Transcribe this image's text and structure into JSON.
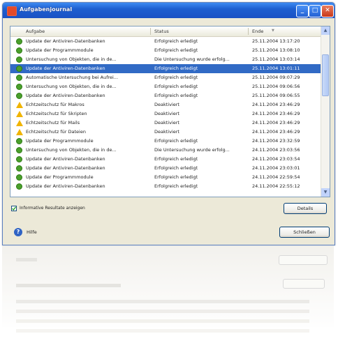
{
  "window": {
    "title": "Aufgabenjournal"
  },
  "titlebar_buttons": {
    "minimize": "_",
    "maximize": "□",
    "close": "✕"
  },
  "columns": [
    "Aufgabe",
    "Status",
    "Ende"
  ],
  "sort_indicator": "▼",
  "rows": [
    {
      "icon": "ok",
      "task": "Update der Antiviren-Datenbanken",
      "status": "Erfolgreich erledigt",
      "end": "25.11.2004 13:17:20"
    },
    {
      "icon": "ok",
      "task": "Update der Programmmodule",
      "status": "Erfolgreich erledigt",
      "end": "25.11.2004 13:08:10"
    },
    {
      "icon": "ok",
      "task": "Untersuchung von Objekten, die in de...",
      "status": "Die Untersuchung wurde erfolg...",
      "end": "25.11.2004 13:03:14"
    },
    {
      "icon": "ok",
      "task": "Update der Antiviren-Datenbanken",
      "status": "Erfolgreich erledigt",
      "end": "25.11.2004 13:01:11",
      "selected": true
    },
    {
      "icon": "ok",
      "task": "Automatische Untersuchung bei Aufrei...",
      "status": "Erfolgreich erledigt",
      "end": "25.11.2004 09:07:29"
    },
    {
      "icon": "ok",
      "task": "Untersuchung von Objekten, die in de...",
      "status": "Erfolgreich erledigt",
      "end": "25.11.2004 09:06:56"
    },
    {
      "icon": "ok",
      "task": "Update der Antiviren-Datenbanken",
      "status": "Erfolgreich erledigt",
      "end": "25.11.2004 09:06:55"
    },
    {
      "icon": "warn",
      "task": "Echtzeitschutz für Makros",
      "status": "Deaktiviert",
      "end": "24.11.2004 23:46:29"
    },
    {
      "icon": "warn",
      "task": "Echtzeitschutz für Skripten",
      "status": "Deaktiviert",
      "end": "24.11.2004 23:46:29"
    },
    {
      "icon": "warn",
      "task": "Echtzeitschutz für Mails",
      "status": "Deaktiviert",
      "end": "24.11.2004 23:46:29"
    },
    {
      "icon": "warn",
      "task": "Echtzeitschutz für Dateien",
      "status": "Deaktiviert",
      "end": "24.11.2004 23:46:29"
    },
    {
      "icon": "ok",
      "task": "Update der Programmmodule",
      "status": "Erfolgreich erledigt",
      "end": "24.11.2004 23:32:59"
    },
    {
      "icon": "ok",
      "task": "Untersuchung von Objekten, die in de...",
      "status": "Die Untersuchung wurde erfolg...",
      "end": "24.11.2004 23:03:56"
    },
    {
      "icon": "ok",
      "task": "Update der Antiviren-Datenbanken",
      "status": "Erfolgreich erledigt",
      "end": "24.11.2004 23:03:54"
    },
    {
      "icon": "ok",
      "task": "Update der Antiviren-Datenbanken",
      "status": "Erfolgreich erledigt",
      "end": "24.11.2004 23:03:01"
    },
    {
      "icon": "ok",
      "task": "Update der Programmmodule",
      "status": "Erfolgreich erledigt",
      "end": "24.11.2004 22:59:54"
    },
    {
      "icon": "ok",
      "task": "Update der Antiviren-Datenbanken",
      "status": "Erfolgreich erledigt",
      "end": "24.11.2004 22:55:12"
    }
  ],
  "checkbox": {
    "label": "Informative Resultate anzeigen",
    "checked": true
  },
  "buttons": {
    "details": "Details",
    "close": "Schließen"
  },
  "help": {
    "label": "Hilfe"
  },
  "colors": {
    "selection": "#316ac5",
    "titlebar": "#1e5fd0",
    "ok_icon": "#4aa02c",
    "warn_icon": "#f0b400"
  }
}
